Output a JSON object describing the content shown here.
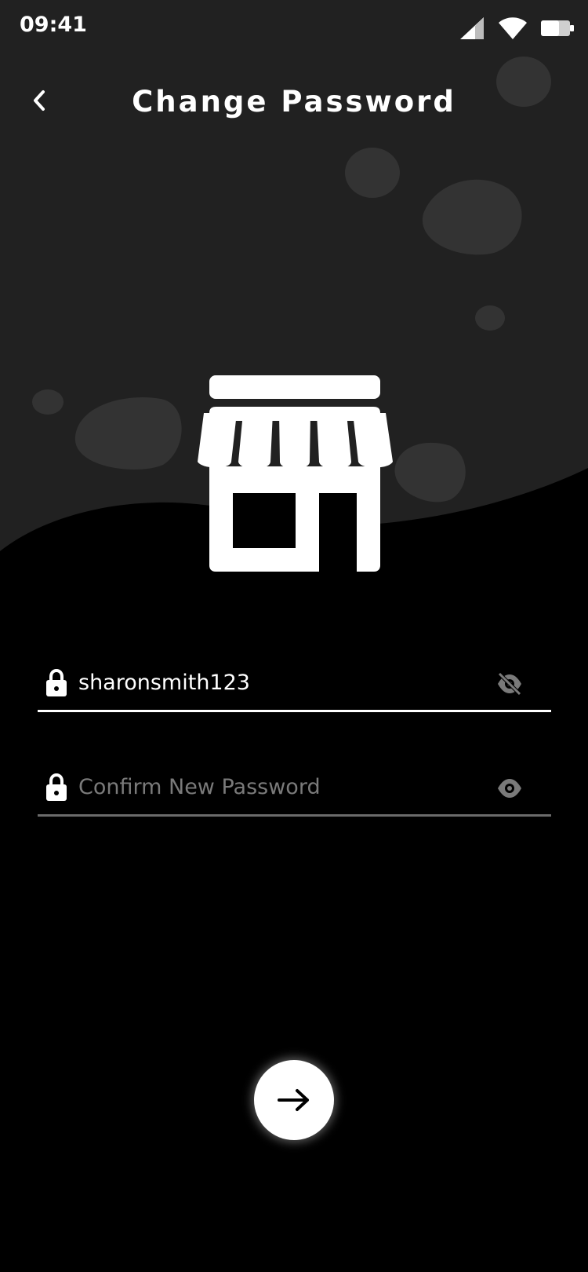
{
  "status_bar": {
    "time": "09:41",
    "icons": [
      "cellular-signal-icon",
      "wifi-icon",
      "battery-icon"
    ]
  },
  "header": {
    "back_icon": "chevron-left-icon",
    "title": "Change Password"
  },
  "logo": {
    "icon": "storefront-icon"
  },
  "form": {
    "new_password": {
      "icon": "lock-icon",
      "value": "sharonsmith123",
      "placeholder": "",
      "visibility_icon": "eye-off-icon"
    },
    "confirm_password": {
      "icon": "lock-icon",
      "value": "",
      "placeholder": "Confirm New Password",
      "visibility_icon": "eye-icon"
    }
  },
  "submit": {
    "icon": "arrow-right-icon"
  },
  "colors": {
    "background": "#000000",
    "top_panel": "#212121",
    "blob": "#333333",
    "text": "#ffffff",
    "muted": "#7a7a7a",
    "active_underline": "#ffffff",
    "inactive_underline": "#6b6b6b"
  }
}
